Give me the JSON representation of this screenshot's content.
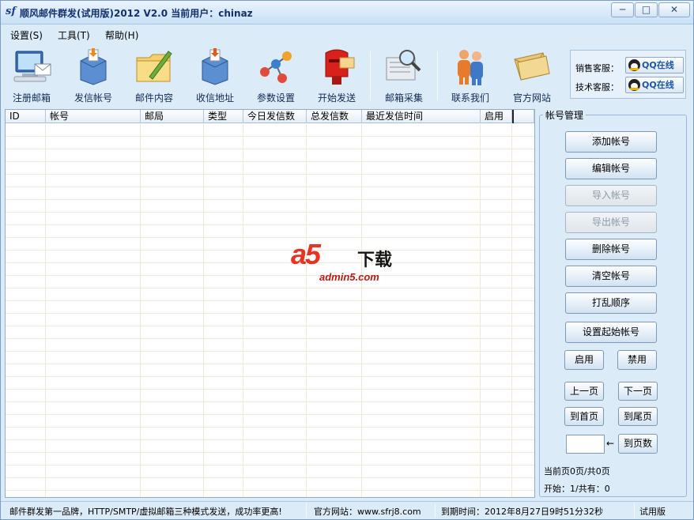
{
  "window": {
    "title": "顺风邮件群发(试用版)2012 V2.0  当前用户：chinaz",
    "icon": "sf",
    "controls": {
      "minimize": "─",
      "maximize": "□",
      "close": "✕"
    }
  },
  "menu": [
    {
      "label": "设置(S)"
    },
    {
      "label": "工具(T)"
    },
    {
      "label": "帮助(H)"
    }
  ],
  "toolbar": [
    {
      "label": "注册邮箱",
      "icon": "computer-mail-icon"
    },
    {
      "label": "发信帐号",
      "icon": "ballot-box-icon"
    },
    {
      "label": "邮件内容",
      "icon": "folder-pen-icon"
    },
    {
      "label": "收信地址",
      "icon": "ballot-box-icon"
    },
    {
      "label": "参数设置",
      "icon": "molecule-icon"
    },
    {
      "label": "开始发送",
      "icon": "mailbox-icon"
    },
    {
      "label": "邮箱采集",
      "icon": "newspaper-magnifier-icon"
    },
    {
      "label": "联系我们",
      "icon": "people-icon"
    },
    {
      "label": "官方网站",
      "icon": "envelope-icon"
    }
  ],
  "support": {
    "sales_label": "销售客服：",
    "tech_label": "技术客服：",
    "qq_button": "QQ在线"
  },
  "table": {
    "columns": [
      "ID",
      "帐号",
      "邮局",
      "类型",
      "今日发信数",
      "总发信数",
      "最近发信时间",
      "启用",
      ""
    ],
    "rows": []
  },
  "watermark": {
    "brand": "a5",
    "suffix": "下载",
    "url": "admin5.com"
  },
  "account_panel": {
    "title": "帐号管理",
    "add": "添加帐号",
    "edit": "编辑帐号",
    "import": "导入帐号",
    "export": "导出帐号",
    "delete": "删除帐号",
    "clear": "清空帐号",
    "shuffle": "打乱顺序",
    "set_start": "设置起始帐号",
    "enable": "启用",
    "disable": "禁用",
    "prev_page": "上一页",
    "next_page": "下一页",
    "first_page": "到首页",
    "last_page": "到尾页",
    "go_page": "到页数",
    "page_input": "",
    "arrow": "←",
    "page_info": "当前页0页/共0页",
    "start_info": "开始：1/共有：0"
  },
  "status": {
    "slogan": "邮件群发第一品牌，HTTP/SMTP/虚拟邮箱三种模式发送，成功率更高!",
    "website": "官方网站：www.sfrj8.com",
    "expiry": "到期时间：2012年8月27日9时51分32秒",
    "edition": "试用版"
  },
  "colors": {
    "window_bg": "#dcebf8",
    "title_text": "#14306f",
    "accent_blue": "#1c56a4",
    "watermark_red": "#e63323"
  }
}
